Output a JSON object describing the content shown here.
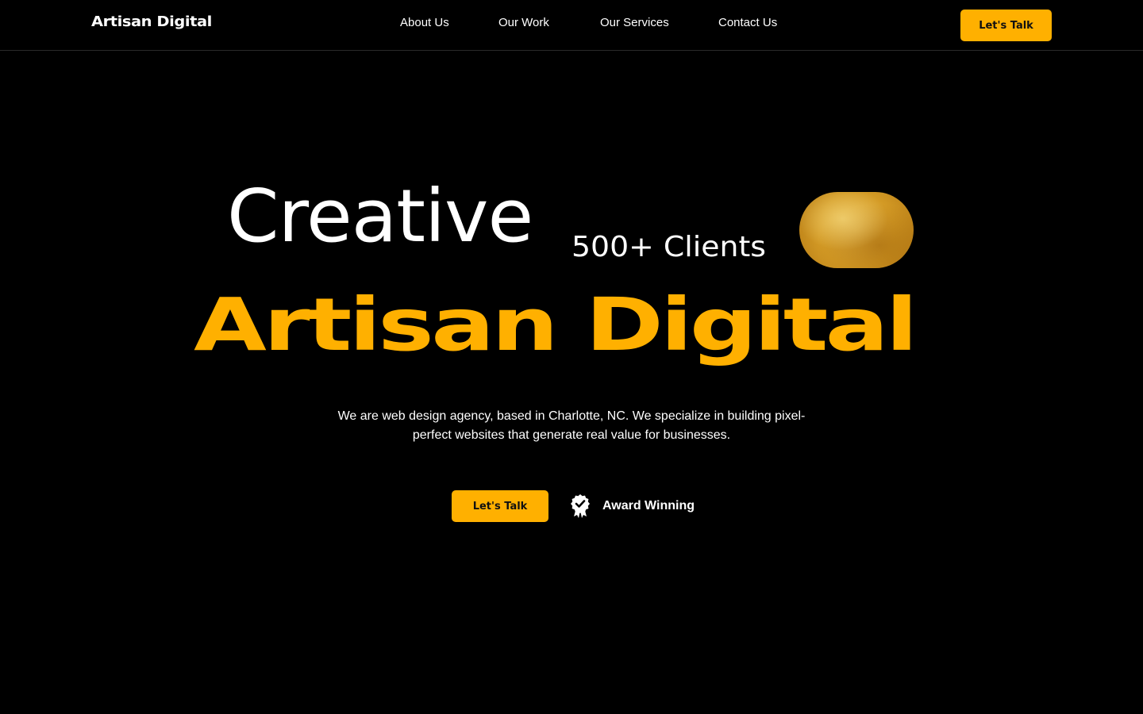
{
  "header": {
    "logo": "Artisan Digital",
    "nav": [
      {
        "label": "About Us"
      },
      {
        "label": "Our Work"
      },
      {
        "label": "Our Services"
      },
      {
        "label": "Contact Us"
      }
    ],
    "cta_label": "Let's Talk"
  },
  "hero": {
    "line1": "Creative",
    "clients": "500+ Clients",
    "title": "Artisan Digital",
    "description": "We are web design agency, based in Charlotte, NC. We specialize in building pixel-perfect websites that generate real value for businesses.",
    "cta_label": "Let's Talk",
    "award_label": "Award Winning",
    "award_icon": "award-badge-icon",
    "image": "golden-blob-image"
  },
  "colors": {
    "background": "#000000",
    "accent": "#ffb000",
    "text": "#ffffff"
  }
}
